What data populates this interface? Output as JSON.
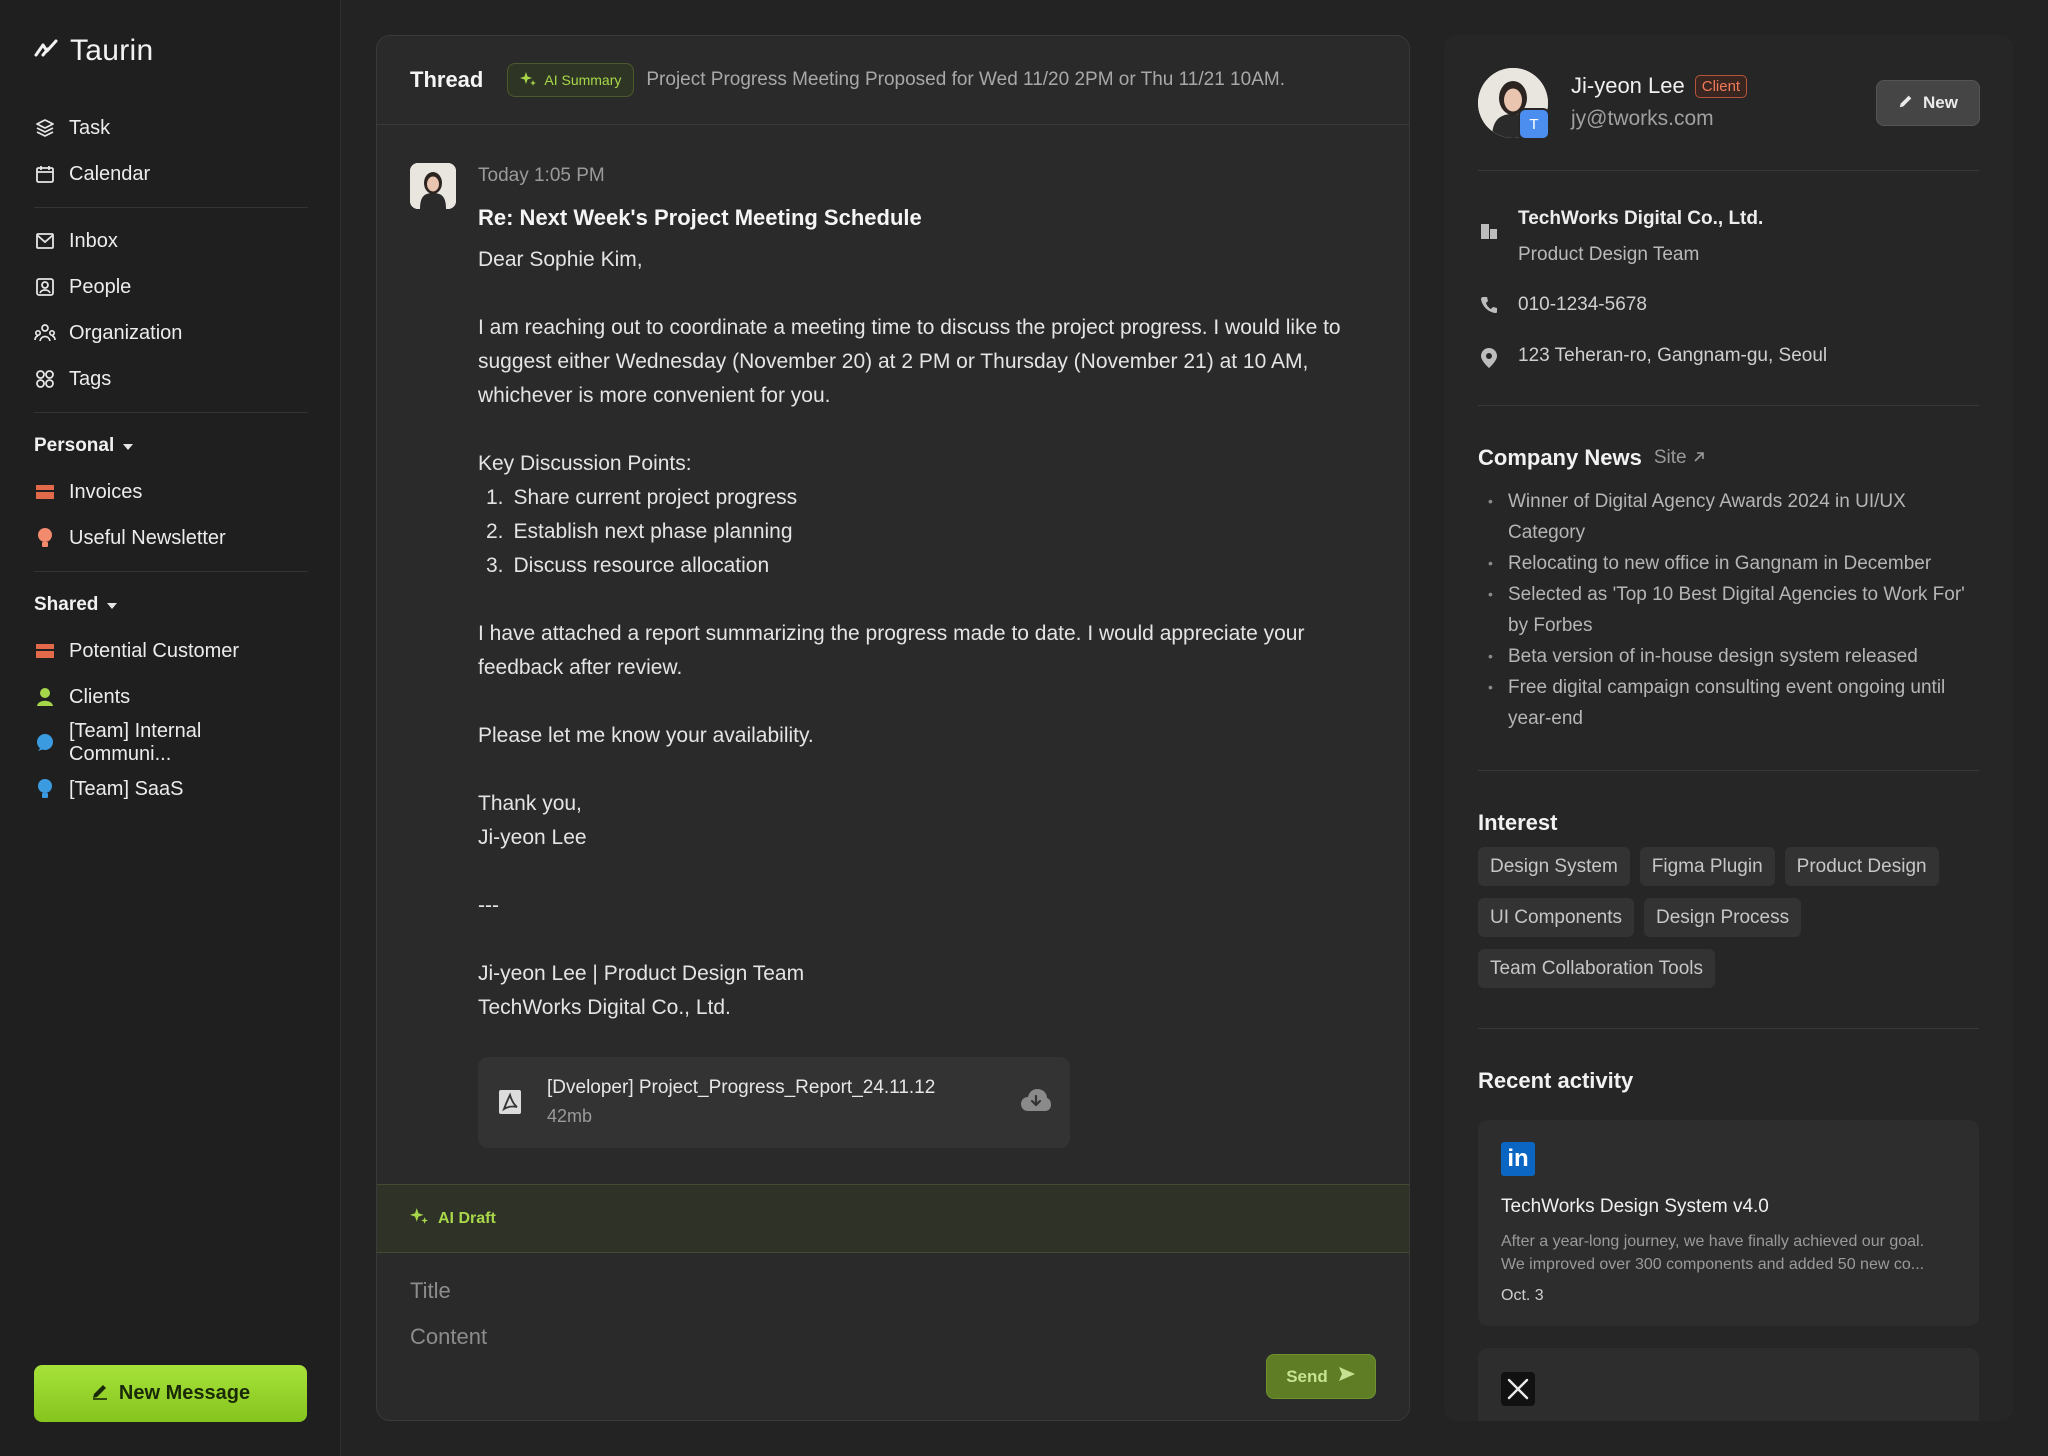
{
  "app": {
    "name": "Taurin"
  },
  "sidebar": {
    "main": [
      {
        "label": "Task",
        "icon": "layers-icon"
      },
      {
        "label": "Calendar",
        "icon": "calendar-icon"
      }
    ],
    "secondary": [
      {
        "label": "Inbox",
        "icon": "mail-icon"
      },
      {
        "label": "People",
        "icon": "person-icon"
      },
      {
        "label": "Organization",
        "icon": "organization-icon"
      },
      {
        "label": "Tags",
        "icon": "tags-icon"
      }
    ],
    "personal": {
      "label": "Personal",
      "items": [
        {
          "label": "Invoices",
          "icon": "folder-icon",
          "color": "#e2694a"
        },
        {
          "label": "Useful Newsletter",
          "icon": "bulb-icon",
          "color": "#f28b6e"
        }
      ]
    },
    "shared": {
      "label": "Shared",
      "items": [
        {
          "label": "Potential Customer",
          "icon": "folder-icon",
          "color": "#e2694a"
        },
        {
          "label": "Clients",
          "icon": "person-icon",
          "color": "#a6d64a"
        },
        {
          "label": "[Team] Internal Communi...",
          "icon": "chat-icon",
          "color": "#3b9be0"
        },
        {
          "label": "[Team] SaaS",
          "icon": "bulb-icon",
          "color": "#3b9be0"
        }
      ]
    },
    "new_message": "New Message"
  },
  "thread": {
    "title": "Thread",
    "ai_badge": "AI Summary",
    "summary": "Project Progress Meeting Proposed for Wed 11/20 2PM or Thu 11/21 10AM.",
    "message": {
      "time": "Today 1:05 PM",
      "subject": "Re: Next Week's Project Meeting Schedule",
      "greeting": "Dear Sophie Kim,",
      "para1": "I am reaching out to coordinate a meeting time to discuss the project progress. I would like to suggest either Wednesday (November 20) at 2 PM or Thursday (November 21) at 10 AM, whichever is more convenient for you.",
      "points_title": "Key Discussion Points:",
      "points": [
        "Share current project progress",
        "Establish next phase planning",
        "Discuss resource allocation"
      ],
      "para2": "I have attached a report summarizing the progress made to date. I would appreciate your feedback after review.",
      "para3": "Please let me know your availability.",
      "closing": "Thank you,",
      "signer": "Ji-yeon Lee",
      "separator": "---",
      "sig_line1": "Ji-yeon Lee | Product Design Team",
      "sig_line2": "TechWorks Digital Co., Ltd."
    },
    "attachment": {
      "name": "[Dveloper] Project_Progress_Report_24.11.12",
      "size": "42mb"
    },
    "ai_draft": "AI Draft",
    "draft_title_placeholder": "Title",
    "draft_content_placeholder": "Content",
    "send": "Send"
  },
  "contact": {
    "name": "Ji-yeon Lee",
    "badge": "Client",
    "email": "jy@tworks.com",
    "avatar_letter": "T",
    "new_button": "New",
    "company": "TechWorks Digital Co., Ltd.",
    "team": "Product Design Team",
    "phone": "010-1234-5678",
    "address": "123 Teheran-ro, Gangnam-gu, Seoul"
  },
  "news": {
    "title": "Company News",
    "site": "Site",
    "items": [
      "Winner of Digital Agency Awards 2024 in UI/UX Category",
      "Relocating to new office in Gangnam in December",
      "Selected as 'Top 10 Best Digital Agencies to Work For' by Forbes",
      "Beta version of in-house design system released",
      "Free digital campaign consulting event ongoing until year-end"
    ]
  },
  "interest": {
    "title": "Interest",
    "tags": [
      "Design System",
      "Figma Plugin",
      "Product Design",
      "UI Components",
      "Design Process",
      "Team Collaboration Tools"
    ]
  },
  "activity": {
    "title": "Recent activity",
    "items": [
      {
        "source": "linkedin-icon",
        "title": "TechWorks Design System v4.0",
        "desc1": "After a year-long journey, we have finally achieved our goal.",
        "desc2": "We improved over 300 components and added 50 new co...",
        "date": "Oct. 3"
      }
    ]
  },
  "colors": {
    "accent": "#a6e23a",
    "client_badge": "#f07a5a"
  }
}
